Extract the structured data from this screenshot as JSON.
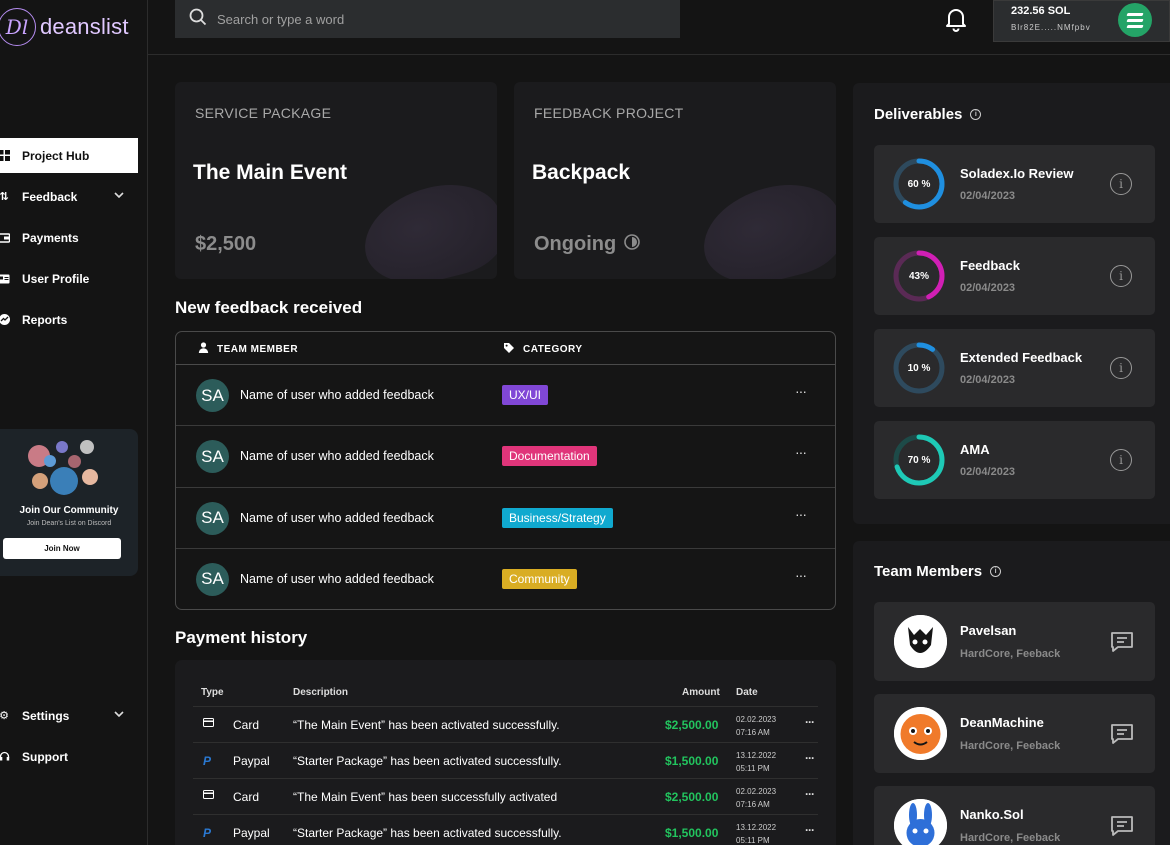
{
  "brand": {
    "logo_mark": "Dl",
    "name": "deanslist"
  },
  "search": {
    "placeholder": "Search or type a word"
  },
  "wallet": {
    "balance": "232.56 SOL",
    "address": "Blr82E.....NMfpbv"
  },
  "nav": {
    "items": [
      {
        "label": "Project Hub",
        "icon": "grid-icon",
        "active": true
      },
      {
        "label": "Feedback",
        "icon": "sort-arrows-icon",
        "has_chevron": true
      },
      {
        "label": "Payments",
        "icon": "wallet-icon"
      },
      {
        "label": "User Profile",
        "icon": "id-card-icon"
      },
      {
        "label": "Reports",
        "icon": "chart-icon"
      }
    ],
    "bottom": [
      {
        "label": "Settings",
        "icon": "gear-icon",
        "has_chevron": true
      },
      {
        "label": "Support",
        "icon": "headset-icon"
      }
    ]
  },
  "community": {
    "title": "Join Our Community",
    "subtitle": "Join Dean's List on Discord",
    "button": "Join Now"
  },
  "packages": [
    {
      "label": "SERVICE PACKAGE",
      "title": "The Main Event",
      "value": "$2,500"
    },
    {
      "label": "FEEDBACK PROJECT",
      "title": "Backpack",
      "value": "Ongoing"
    }
  ],
  "feedback": {
    "title": "New feedback received",
    "col_member": "TEAM MEMBER",
    "col_category": "CATEGORY",
    "rows": [
      {
        "initials": "SA",
        "name": "Name of user who added feedback",
        "category": "UX/UI",
        "color": "#8047d6"
      },
      {
        "initials": "SA",
        "name": "Name of user who added feedback",
        "category": "Documentation",
        "color": "#e0357a"
      },
      {
        "initials": "SA",
        "name": "Name of user who added feedback",
        "category": "Business/Strategy",
        "color": "#10a9cf"
      },
      {
        "initials": "SA",
        "name": "Name of user who added feedback",
        "category": "Community",
        "color": "#d9ad23"
      }
    ]
  },
  "payments": {
    "title": "Payment history",
    "headers": {
      "type": "Type",
      "description": "Description",
      "amount": "Amount",
      "date": "Date"
    },
    "rows": [
      {
        "type": "Card",
        "description": "“The Main Event” has been activated successfully.",
        "amount": "$2,500.00",
        "date": "02.02.2023",
        "time": "07:16 AM"
      },
      {
        "type": "Paypal",
        "description": "“Starter Package” has been activated successfully.",
        "amount": "$1,500.00",
        "date": "13.12.2022",
        "time": "05:11 PM"
      },
      {
        "type": "Card",
        "description": "“The Main Event” has been successfully activated",
        "amount": "$2,500.00",
        "date": "02.02.2023",
        "time": "07:16 AM"
      },
      {
        "type": "Paypal",
        "description": "“Starter Package” has been activated successfully.",
        "amount": "$1,500.00",
        "date": "13.12.2022",
        "time": "05:11 PM"
      }
    ]
  },
  "deliverables": {
    "title": "Deliverables",
    "items": [
      {
        "progress_label": "60 %",
        "progress": 0.6,
        "name": "Soladex.Io Review",
        "date": "02/04/2023",
        "color": "#1f8fe0"
      },
      {
        "progress_label": "43%",
        "progress": 0.43,
        "name": "Feedback",
        "date": "02/04/2023",
        "color": "#d11fb5"
      },
      {
        "progress_label": "10 %",
        "progress": 0.1,
        "name": "Extended Feedback",
        "date": "02/04/2023",
        "color": "#1f8fe0"
      },
      {
        "progress_label": "70 %",
        "progress": 0.7,
        "name": "AMA",
        "date": "02/04/2023",
        "color": "#1ec9b6"
      }
    ]
  },
  "team": {
    "title": "Team Members",
    "members": [
      {
        "name": "Pavelsan",
        "role": "HardCore, Feeback"
      },
      {
        "name": "DeanMachine",
        "role": "HardCore, Feeback"
      },
      {
        "name": "Nanko.Sol",
        "role": "HardCore, Feeback"
      }
    ]
  }
}
